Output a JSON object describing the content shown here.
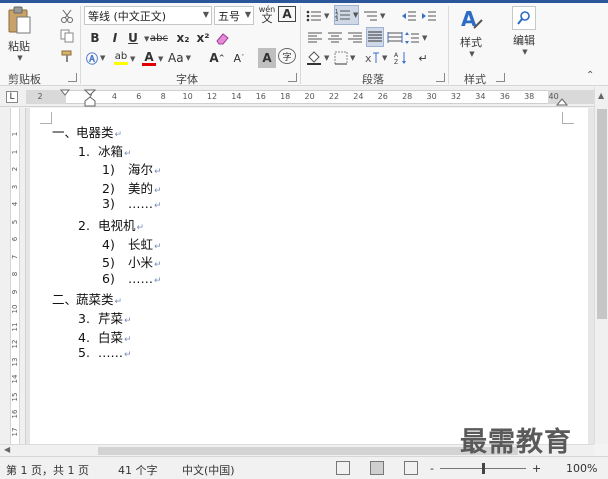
{
  "ribbon": {
    "clipboard": {
      "paste_label": "粘贴",
      "group_label": "剪贴板"
    },
    "font": {
      "font_name": "等线 (中文正文)",
      "font_size": "五号",
      "phonetic_label": "wén",
      "bold": "B",
      "italic": "I",
      "underline": "U",
      "strike": "abc",
      "subscript": "x₂",
      "superscript": "x²",
      "change_case": "Aa",
      "grow": "A",
      "shrink": "A",
      "char_shade": "A",
      "enclose": "字",
      "group_label": "字体"
    },
    "paragraph": {
      "group_label": "段落"
    },
    "styles": {
      "styles_label": "样式",
      "group_label": "样式"
    },
    "editing": {
      "editing_label": "编辑"
    }
  },
  "ruler": {
    "numbers": [
      "2",
      "2",
      "4",
      "6",
      "8",
      "10",
      "12",
      "14",
      "16",
      "18",
      "20",
      "22",
      "24",
      "26",
      "28",
      "30",
      "32",
      "34",
      "36",
      "38",
      "40"
    ],
    "tab_label": "L"
  },
  "vruler": {
    "numbers": [
      "1",
      "1",
      "2",
      "3",
      "4",
      "5",
      "6",
      "7",
      "8",
      "9",
      "10",
      "11",
      "12",
      "13",
      "14",
      "15",
      "16",
      "17",
      "18"
    ]
  },
  "document": {
    "lines": [
      {
        "num": "一、",
        "text": "电器类"
      },
      {
        "num": "1.",
        "text": "冰箱"
      },
      {
        "num": "1)",
        "text": "海尔"
      },
      {
        "num": "2)",
        "text": "美的"
      },
      {
        "num": "3)",
        "text": "……"
      },
      {
        "num": "2.",
        "text": "电视机"
      },
      {
        "num": "4)",
        "text": "长虹"
      },
      {
        "num": "5)",
        "text": "小米"
      },
      {
        "num": "6)",
        "text": "……"
      },
      {
        "num": "二、",
        "text": "蔬菜类"
      },
      {
        "num": "3.",
        "text": "芹菜"
      },
      {
        "num": "4.",
        "text": "白菜"
      },
      {
        "num": "5.",
        "text": "……"
      }
    ],
    "paragraph_mark": "↵"
  },
  "status": {
    "page_info": "第 1 页，共 1 页",
    "word_count": "41 个字",
    "language": "中文(中国)",
    "zoom_minus": "-",
    "zoom_plus": "+",
    "zoom_level": "100%",
    "zoom_fraction": 0.5
  },
  "watermark": "最需教育",
  "colors": {
    "accent": "#2b579a",
    "font_color_red": "#e00000",
    "highlight_yellow": "#ffff00"
  }
}
